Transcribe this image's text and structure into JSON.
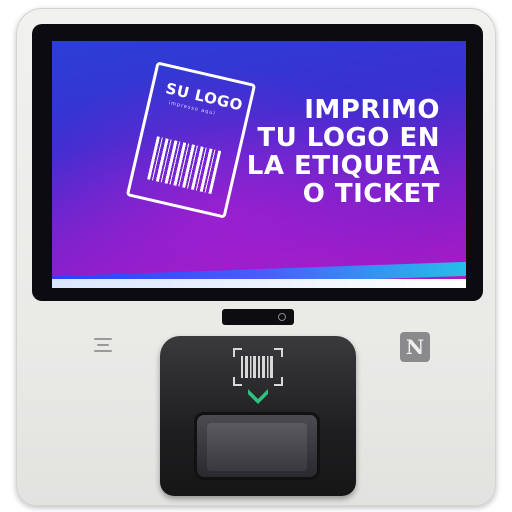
{
  "screen": {
    "label_logo_text": "SU LOGO",
    "label_sub_text": "impresso aqui",
    "headline_lines": [
      "IMPRIMO",
      "TU LOGO EN",
      "LA ETIQUETA",
      "O TICKET"
    ]
  },
  "hardware": {
    "nfc_symbol": "N",
    "icons": [
      "speaker-icon",
      "nfc-icon",
      "barcode-scan-icon",
      "arrow-down-icon",
      "camera-icon"
    ]
  },
  "colors": {
    "screen_blue": "#2b3fd6",
    "screen_magenta": "#b118c6",
    "kiosk_body": "#ececea",
    "scanner_body": "#1e1e20",
    "arrow_green": "#2ec27e"
  }
}
